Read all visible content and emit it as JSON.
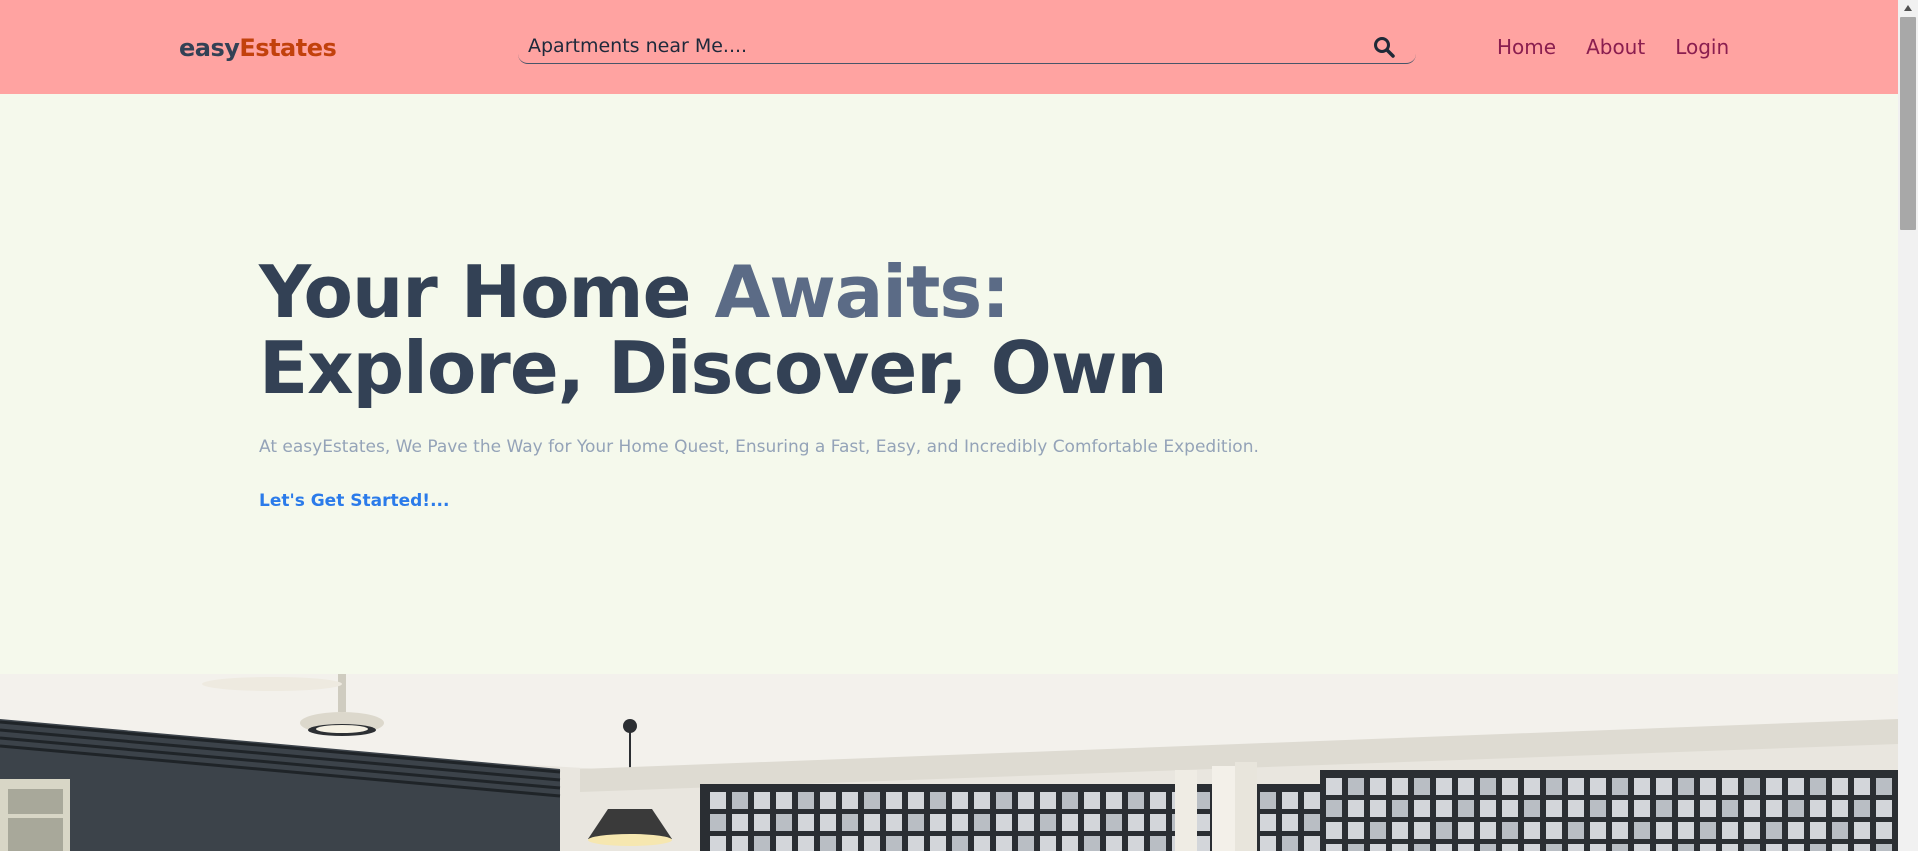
{
  "brand": {
    "part1": "easy",
    "part2": "Estates"
  },
  "search": {
    "placeholder": "Apartments near Me....",
    "icon": "search-icon"
  },
  "nav": {
    "items": [
      {
        "label": "Home"
      },
      {
        "label": "About"
      },
      {
        "label": "Login"
      }
    ]
  },
  "hero": {
    "title_line1_a": "Your Home ",
    "title_line1_b": "Awaits:",
    "title_line2": "Explore, Discover, Own",
    "subtitle": "At easyEstates, We Pave the Way for Your Home Quest, Ensuring a Fast, Easy, and Incredibly Comfortable Expedition.",
    "cta": "Let's Get Started!..."
  },
  "colors": {
    "navbar_bg": "#ffa3a1",
    "page_bg": "#f5f9ec",
    "brand_dark": "#334155",
    "brand_accent": "#c2410c",
    "nav_link": "#8a1e4f",
    "title_accent": "#5b6b86",
    "cta": "#2b7bea"
  },
  "scrollbar": {
    "scroll_position": 0
  }
}
